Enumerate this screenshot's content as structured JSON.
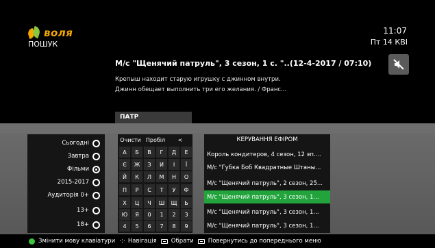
{
  "brand": {
    "name": "воля"
  },
  "header": {
    "section": "ПОШУК",
    "time": "11:07",
    "date": "Пт 14 КВІ"
  },
  "program": {
    "title": "М/с \"Щенячий патруль\", 3 сезон, 1 с. \"..(12-4-2017 / 07:10)",
    "description_lines": [
      "Крепыш находит старую игрушку с джинном внутри.",
      "Джинн обещает выполнить три его желания. / Франс..."
    ]
  },
  "search": {
    "value": "ПАТР"
  },
  "filters": [
    {
      "label": "Сьогодні",
      "selected": false
    },
    {
      "label": "Завтра",
      "selected": false
    },
    {
      "label": "Фільми",
      "selected": true
    },
    {
      "label": "2015-2017",
      "selected": false
    },
    {
      "label": "Аудиторія 0+",
      "selected": false
    },
    {
      "label": "13+",
      "selected": false
    },
    {
      "label": "18+",
      "selected": false
    }
  ],
  "keyboard": {
    "controls": [
      "Очисти",
      "Пробіл",
      "<"
    ],
    "rows": [
      [
        "А",
        "Б",
        "В",
        "Г",
        "Д",
        "Е"
      ],
      [
        "Є",
        "Ж",
        "З",
        "И",
        "І",
        "Ї"
      ],
      [
        "Й",
        "К",
        "Л",
        "М",
        "Н",
        "О"
      ],
      [
        "П",
        "Р",
        "С",
        "Т",
        "У",
        "Ф"
      ],
      [
        "Х",
        "Ц",
        "Ч",
        "Ш",
        "Щ",
        "Ь"
      ],
      [
        "Ю",
        "Я",
        "0",
        "1",
        "2",
        "3"
      ],
      [
        "4",
        "5",
        "6",
        "7",
        "8",
        "9"
      ]
    ]
  },
  "channels": {
    "header": "КЕРУВАННЯ ЕФІРОМ",
    "items": [
      {
        "label": "Король кондитеров, 4 сезон, 12 эп....",
        "selected": false
      },
      {
        "label": "М/с \"Губка Боб Квадратные Штаны...",
        "selected": false
      },
      {
        "label": "М/с \"Щенячий патруль\", 2 сезон, 25...",
        "selected": false
      },
      {
        "label": "М/с \"Щенячий патруль\", 3 сезон, 1...",
        "selected": true
      },
      {
        "label": "М/с \"Щенячий патруль\", 3 сезон, 1...",
        "selected": false
      },
      {
        "label": "М/с \"Щенячий патруль\", 3 сезон, 1...",
        "selected": false
      }
    ]
  },
  "footer": {
    "change_keyboard": "Змінити мову клавіатури",
    "navigation": "Навігація",
    "select": "Обрати",
    "back": "Повернутись до попереднього меню"
  },
  "colors": {
    "brand_orange": "#f5a800",
    "brand_green": "#8cc63f",
    "selection_green": "#22a33c",
    "panel_gray": "#6c6c6c"
  },
  "icons": {
    "mute": "mute-icon",
    "navigation": "dpad-icon",
    "ok": "ok-button-icon",
    "back": "back-button-icon"
  }
}
